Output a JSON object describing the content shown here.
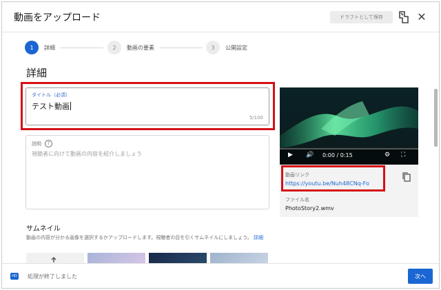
{
  "dialog": {
    "title": "動画をアップロード",
    "draft_button": "ドラフトとして保存",
    "close_glyph": "✕"
  },
  "stepper": {
    "steps": [
      {
        "number": "1",
        "label": "詳細",
        "active": true
      },
      {
        "number": "2",
        "label": "動画の要素",
        "active": false
      },
      {
        "number": "3",
        "label": "公開設定",
        "active": false
      }
    ]
  },
  "details": {
    "section_title": "詳細",
    "title_field": {
      "label": "タイトル（必須）",
      "value": "テスト動画",
      "counter": "5/100"
    },
    "description_field": {
      "label": "説明",
      "placeholder": "視聴者に向けて動画の内容を紹介しましょう"
    }
  },
  "thumbnail": {
    "title": "サムネイル",
    "description": "動画の内容が分かる画像を選択するかアップロードします。視聴者の目を引くサムネイルにしましょう。",
    "link_text": "詳細"
  },
  "preview": {
    "time": "0:00 / 0:15",
    "link_label": "動画リンク",
    "link_value": "https://youtu.be/Nuh48CNq-Fo",
    "file_label": "ファイル名",
    "file_value": "PhotoStory2.wmv"
  },
  "footer": {
    "badge": "HD",
    "status": "処理が終了しました",
    "next_button": "次へ"
  },
  "colors": {
    "accent": "#1a66d2",
    "highlight": "#d60f14"
  },
  "icons": [
    "feedback-icon",
    "close-icon",
    "help-icon",
    "play-icon",
    "volume-icon",
    "settings-icon",
    "fullscreen-icon",
    "copy-icon"
  ]
}
